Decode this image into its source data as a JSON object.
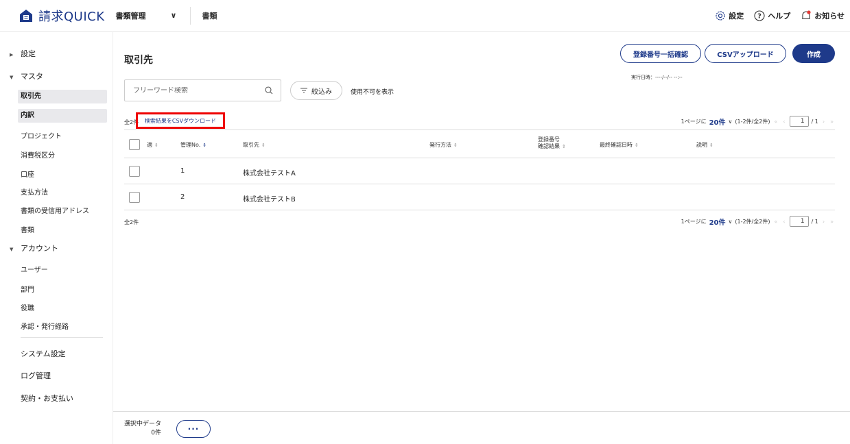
{
  "header": {
    "logo_text": "請求QUICK",
    "module": "書類管理",
    "current_section": "書類",
    "settings_label": "設定",
    "help_label": "ヘルプ",
    "notifications_label": "お知らせ"
  },
  "sidebar": {
    "settings": "設定",
    "master": "マスタ",
    "master_items": [
      "取引先",
      "内訳",
      "プロジェクト",
      "消費税区分",
      "口座",
      "支払方法",
      "書類の受信用アドレス",
      "書類"
    ],
    "account": "アカウント",
    "account_items": [
      "ユーザー",
      "部門",
      "役職",
      "承認・発行経路"
    ],
    "system_settings": "システム設定",
    "log_management": "ログ管理",
    "contract_payment": "契約・お支払い"
  },
  "main": {
    "title": "取引先",
    "btn_registration_check": "登録番号一括確認",
    "btn_csv_upload": "CSVアップロード",
    "btn_create": "作成",
    "exec_date": "実行日時：----/--/-- --:--",
    "search_placeholder": "フリーワード検索",
    "filter_label": "絞込み",
    "show_disabled": "使用不可を表示",
    "count_top": "全2件",
    "csv_download": "検索結果をCSVダウンロード",
    "count_bottom": "全2件"
  },
  "pager": {
    "per_page_prefix": "1ページに",
    "per_page": "20件",
    "range": "(1-2件/全2件)",
    "current_page": "1",
    "total_pages": "/ 1"
  },
  "table": {
    "headers": {
      "app": "適",
      "no": "管理No.",
      "partner": "取引先",
      "method": "発行方法",
      "reg_line1": "登録番号",
      "reg_line2": "確認結果",
      "last_check": "最終確認日時",
      "desc": "説明"
    },
    "rows": [
      {
        "no": "1",
        "partner": "株式会社テストA"
      },
      {
        "no": "2",
        "partner": "株式会社テストB"
      }
    ]
  },
  "footer": {
    "selected_label": "選択中データ",
    "selected_count": "0件",
    "more_label": "···"
  },
  "colors": {
    "accent": "#1e3a8a",
    "highlight": "#ee0000",
    "active_bg": "#e9e9ec"
  }
}
